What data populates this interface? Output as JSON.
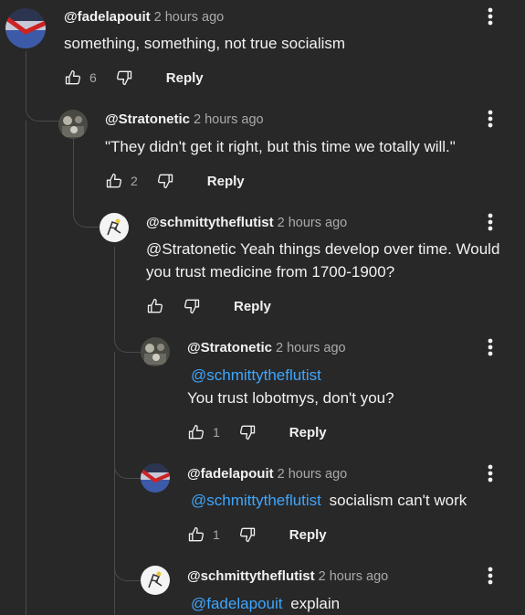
{
  "comments": [
    {
      "handle": "@fadelapouit",
      "time": "2 hours ago",
      "text": "something, something, not true socialism",
      "likes": "6",
      "reply_label": "Reply",
      "avatar": "flag-avatar"
    },
    {
      "handle": "@Stratonetic",
      "time": "2 hours ago",
      "text": "\"They didn't get it right, but this time we totally will.\"",
      "likes": "2",
      "reply_label": "Reply",
      "avatar": "photo-avatar"
    },
    {
      "handle": "@schmittytheflutist",
      "time": "2 hours ago",
      "text": "@Stratonetic Yeah things develop over time. Would you trust medicine from 1700-1900?",
      "likes": "",
      "reply_label": "Reply",
      "avatar": "sketch-avatar"
    },
    {
      "handle": "@Stratonetic",
      "time": "2 hours ago",
      "mention": "@schmittytheflutist",
      "text": "You trust lobotmys, don't you?",
      "likes": "1",
      "reply_label": "Reply",
      "avatar": "photo-avatar"
    },
    {
      "handle": "@fadelapouit",
      "time": "2 hours ago",
      "mention": "@schmittytheflutist",
      "text": "socialism can't work",
      "likes": "1",
      "reply_label": "Reply",
      "avatar": "flag-avatar"
    },
    {
      "handle": "@schmittytheflutist",
      "time": "2 hours ago",
      "mention": "@fadelapouit",
      "text": "explain",
      "avatar": "sketch-avatar"
    }
  ],
  "icons": {
    "like": "thumbs-up-icon",
    "dislike": "thumbs-down-icon",
    "more": "more-vertical-icon"
  },
  "colors": {
    "background": "#282828",
    "mention": "#3ea6ff",
    "muted": "#aaaaaa"
  }
}
